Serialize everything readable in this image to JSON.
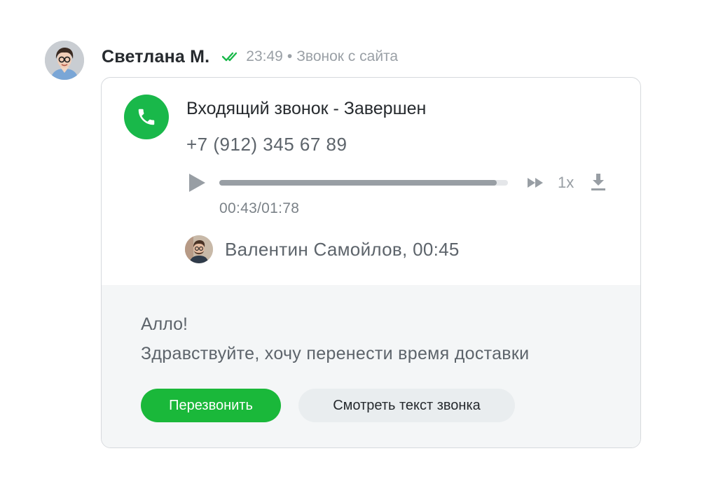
{
  "message": {
    "sender_name": "Светлана М.",
    "time": "23:49",
    "separator": "•",
    "source": "Звонок с сайта",
    "status_icon": "double-check-icon",
    "status_color": "#19b84a"
  },
  "call": {
    "title": "Входящий звонок - Завершен",
    "phone_number": "+7 (912) 345 67 89",
    "icon": "phone-icon",
    "icon_bg": "#19b84a"
  },
  "player": {
    "progress_fraction": 0.96,
    "time_label": "00:43/01:78",
    "speed_label": "1x",
    "play_icon": "play-icon",
    "fast_forward_icon": "fast-forward-icon",
    "download_icon": "download-icon"
  },
  "operator": {
    "line": "Валентин Самойлов, 00:45"
  },
  "transcript": {
    "lines": [
      "Алло!",
      "Здравствуйте, хочу перенести время доставки"
    ]
  },
  "actions": {
    "callback_label": "Перезвонить",
    "view_text_label": "Смотреть текст звонка",
    "callback_color": "#1ab83a"
  }
}
